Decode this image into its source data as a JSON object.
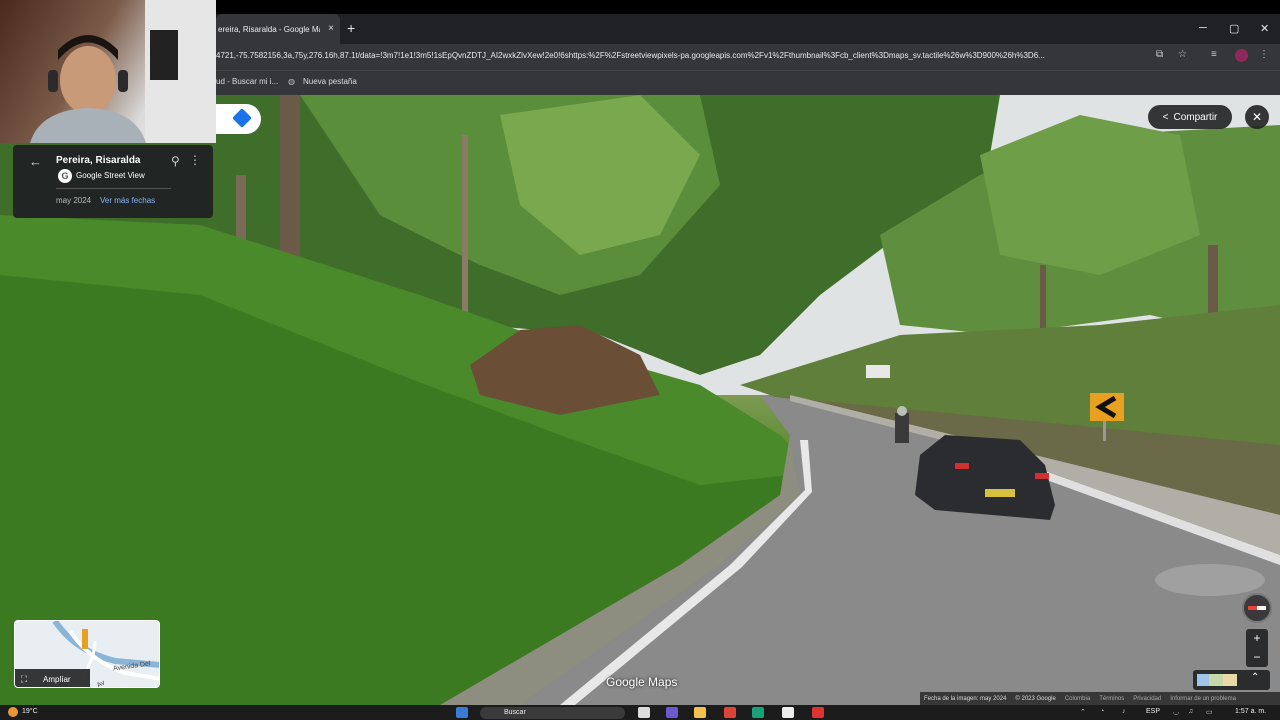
{
  "browser": {
    "tab_title": "ereira, Risaralda - Google Maps",
    "tab_close": "×",
    "new_tab": "+",
    "window_minimize": "─",
    "window_maximize": "▢",
    "window_close": "✕",
    "url": "4721,-75.7582156,3a,75y,276.16h,87.1t/data=!3m7!1e1!3m5!1sEpQvnZDTJ_AI2wxkZlvXew!2e0!6shttps:%2F%2Fstreetviewpixels-pa.googleapis.com%2Fv1%2Fthumbnail%3Fcb_client%3Dmaps_sv.tactile%26w%3D900%26h%3D6...",
    "bookmarks": [
      "ud - Buscar mi i...",
      "Nueva pestaña"
    ]
  },
  "streetview": {
    "place": "Pereira, Risaralda",
    "provider": "Google Street View",
    "date": "may 2024",
    "more_dates": "Ver más fechas",
    "share_label": "Compartir",
    "minimap_expand_label": "Amplíar",
    "minimap_road1": "Avenida Del",
    "minimap_road2": "Av",
    "google_maps_logo": "Google Maps",
    "zoom_in": "+",
    "zoom_out": "−",
    "footer": {
      "image_date": "Fecha de la imagen: may 2024",
      "copyright": "© 2023 Google",
      "country": "Colombia",
      "terms": "Términos",
      "privacy": "Privacidad",
      "report": "Informar de un problema"
    }
  },
  "taskbar": {
    "temperature": "19°C",
    "search_placeholder": "Buscar",
    "language": "ESP",
    "time": "1:57 a. m."
  }
}
